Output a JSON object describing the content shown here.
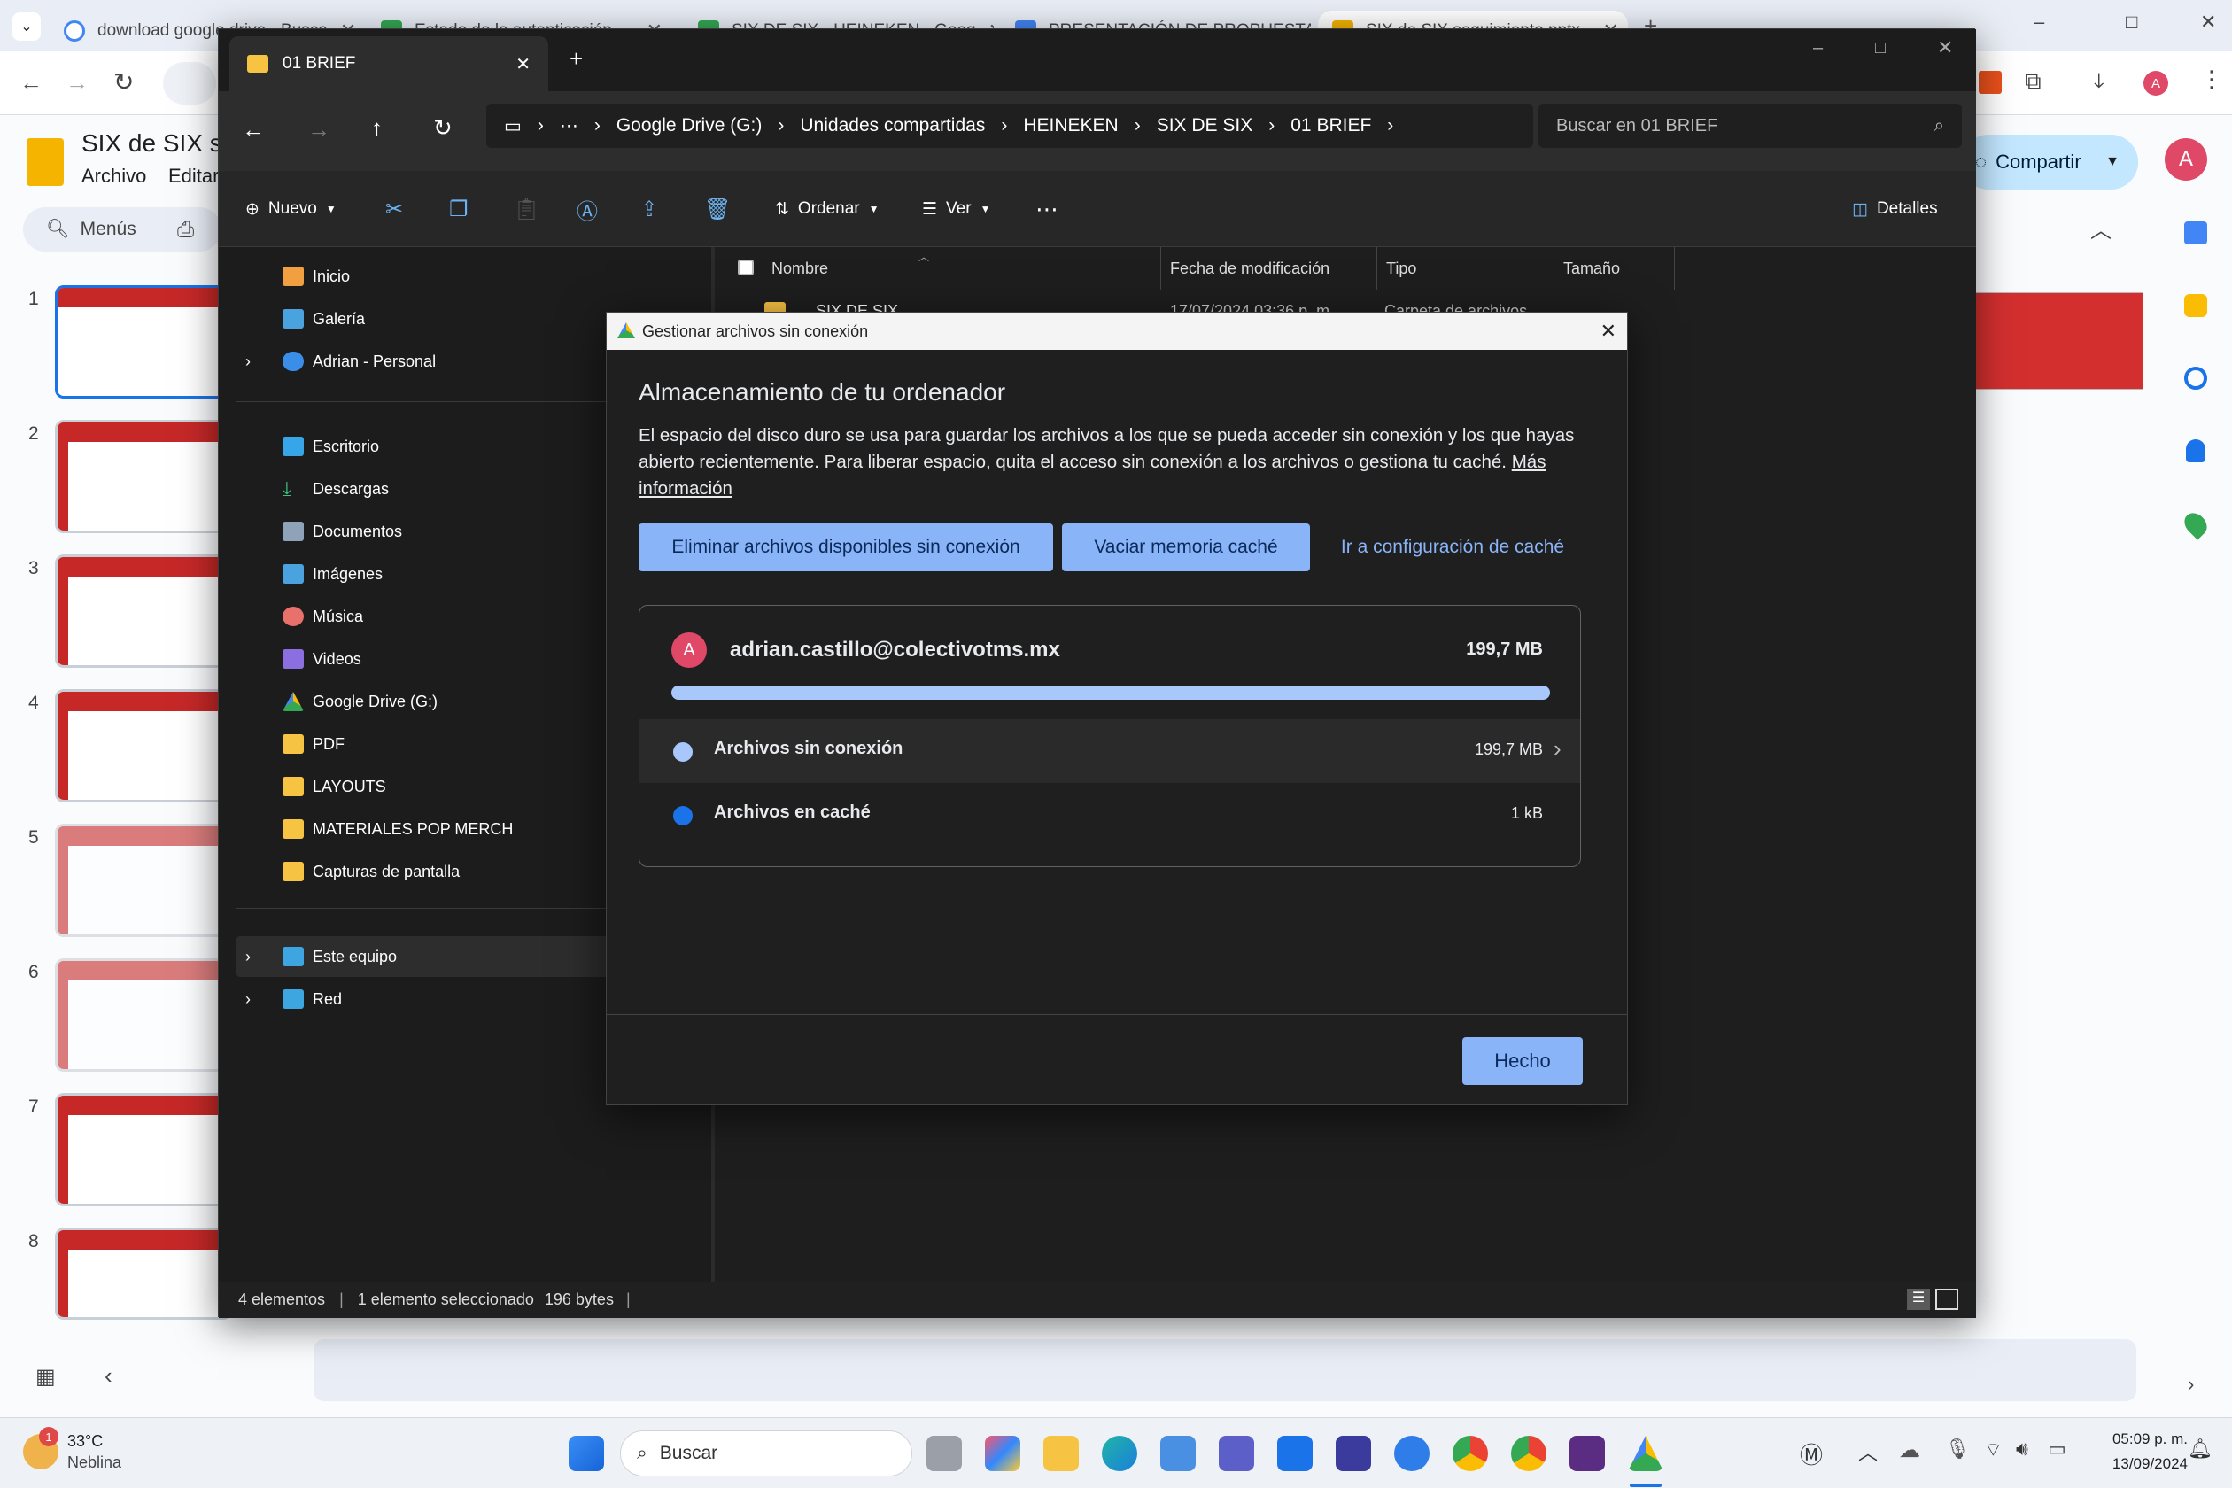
{
  "browser": {
    "tabs": [
      {
        "title": "download google drive - Busca"
      },
      {
        "title": "Estado de la autenticación"
      },
      {
        "title": "SIX DE SIX - HEINEKEN - Goog"
      },
      {
        "title": "PRESENTACIÓN DE PROPUESTA"
      },
      {
        "title": "SIX de SIX seguimiento pptx - "
      }
    ],
    "window_controls": [
      "–",
      "□",
      "✕"
    ]
  },
  "slides": {
    "doc_title": "SIX de SIX se",
    "menu": [
      "Archivo",
      "Editar"
    ],
    "search_menus": "Menús",
    "share_label": "Compartir",
    "avatar_letter": "A",
    "slide_numbers": [
      "1",
      "2",
      "3",
      "4",
      "5",
      "6",
      "7",
      "8"
    ]
  },
  "explorer": {
    "tab_title": "01 BRIEF",
    "breadcrumb": [
      "Google Drive (G:)",
      "Unidades compartidas",
      "HEINEKEN",
      "SIX DE SIX",
      "01 BRIEF"
    ],
    "search_placeholder": "Buscar en 01 BRIEF",
    "commands": {
      "new": "Nuevo",
      "sort": "Ordenar",
      "view": "Ver",
      "details": "Detalles"
    },
    "sidebar": [
      {
        "label": "Inicio",
        "icon": "home-icon",
        "color": "#f0a040"
      },
      {
        "label": "Galería",
        "icon": "gallery-icon",
        "color": "#4aa3df"
      },
      {
        "label": "Adrian - Personal",
        "icon": "onedrive-icon",
        "color": "#3b8ee8"
      },
      {
        "label": "Escritorio",
        "icon": "desktop-icon",
        "color": "#37a6e8"
      },
      {
        "label": "Descargas",
        "icon": "downloads-icon",
        "color": "#3fbf7f"
      },
      {
        "label": "Documentos",
        "icon": "documents-icon",
        "color": "#8ea3b8"
      },
      {
        "label": "Imágenes",
        "icon": "pictures-icon",
        "color": "#4aa3df"
      },
      {
        "label": "Música",
        "icon": "music-icon",
        "color": "#e8716b"
      },
      {
        "label": "Videos",
        "icon": "videos-icon",
        "color": "#8b6fe0"
      },
      {
        "label": "Google Drive (G:)",
        "icon": "google-drive-icon",
        "color": "#34a853"
      },
      {
        "label": "PDF",
        "icon": "folder-icon",
        "color": "#f6c343"
      },
      {
        "label": "LAYOUTS",
        "icon": "folder-icon",
        "color": "#f6c343"
      },
      {
        "label": "MATERIALES POP MERCH",
        "icon": "folder-icon",
        "color": "#f6c343"
      },
      {
        "label": "Capturas de pantalla",
        "icon": "folder-icon",
        "color": "#f6c343"
      },
      {
        "label": "Este equipo",
        "icon": "computer-icon",
        "color": "#3da5e0"
      },
      {
        "label": "Red",
        "icon": "network-icon",
        "color": "#3da5e0"
      }
    ],
    "columns": [
      "Nombre",
      "Fecha de modificación",
      "Tipo",
      "Tamaño"
    ],
    "rows": [
      {
        "name": "SIX DE SIX",
        "date": "17/07/2024 03:36 p. m.",
        "type": "Carpeta de archivos",
        "size": ""
      }
    ],
    "status": {
      "count": "4 elementos",
      "selected": "1 elemento seleccionado",
      "bytes": "196 bytes"
    }
  },
  "dialog": {
    "title": "Gestionar archivos sin conexión",
    "heading": "Almacenamiento de tu ordenador",
    "description": "El espacio del disco duro se usa para guardar los archivos a los que se pueda acceder sin conexión y los que hayas abierto recientemente. Para liberar espacio, quita el acceso sin conexión a los archivos o gestiona tu caché.",
    "learn_more": "Más información",
    "btn_remove_offline": "Eliminar archivos disponibles sin conexión",
    "btn_clear_cache": "Vaciar memoria caché",
    "btn_cache_settings": "Ir a configuración de caché",
    "account": {
      "avatar_letter": "A",
      "email": "adrian.castillo@colectivotms.mx",
      "total": "199,7 MB",
      "usage_fraction": 1.0
    },
    "items": [
      {
        "label": "Archivos sin conexión",
        "size": "199,7 MB",
        "dot_color": "#a8c7fa"
      },
      {
        "label": "Archivos en caché",
        "size": "1 kB",
        "dot_color": "#1a73e8"
      }
    ],
    "done_label": "Hecho"
  },
  "taskbar": {
    "weather_temp": "33°C",
    "weather_desc": "Neblina",
    "weather_badge": "1",
    "search_label": "Buscar",
    "time": "05:09 p. m.",
    "date": "13/09/2024"
  }
}
